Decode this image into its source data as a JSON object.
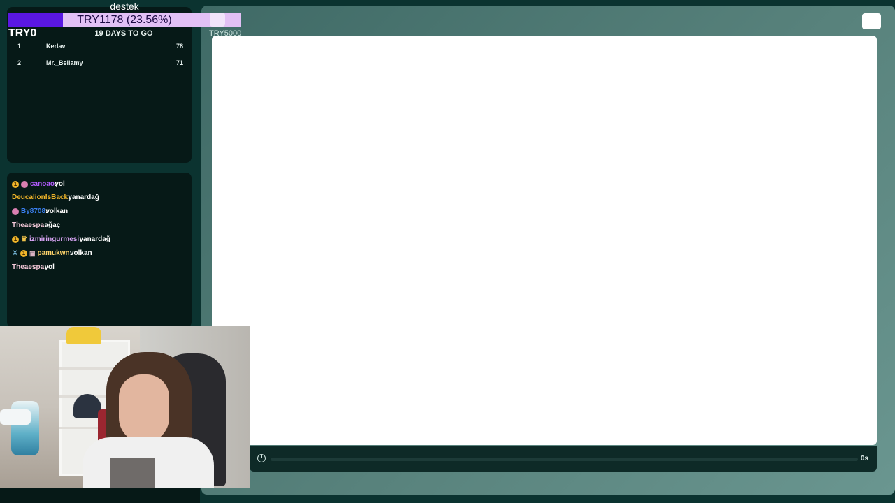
{
  "goal": {
    "title": "destek",
    "bar_label": "TRY1178 (23.56%)",
    "progress_percent": 23.56,
    "start_label": "TRY0",
    "end_label": "TRY5000",
    "days_left": "19 DAYS TO GO",
    "fill_color": "#5a17e3",
    "bar_color": "#e2c0f5"
  },
  "leaderboard": [
    {
      "rank": "1",
      "name": "Kerlav",
      "score": "78"
    },
    {
      "rank": "2",
      "name": "Mr._Bellamy",
      "score": "71"
    }
  ],
  "chat": [
    {
      "badges": [
        "badge-gold",
        "badge-pink"
      ],
      "user": "canoao",
      "user_color": "#b35cff",
      "message": "yol"
    },
    {
      "badges": [],
      "user": "DeucalionIsBack",
      "user_color": "#f0b429",
      "message": "yanardağ"
    },
    {
      "badges": [
        "badge-pink"
      ],
      "user": "By8708",
      "user_color": "#3a7ff0",
      "message": "volkan"
    },
    {
      "badges": [],
      "user": "Theaespa",
      "user_color": "#f2c8d8",
      "message": "ağaç"
    },
    {
      "badges": [
        "badge-gold",
        "badge-crown"
      ],
      "user": "izmiringurmesi",
      "user_color": "#d9a4f5",
      "message": "yanardağ"
    },
    {
      "badges": [
        "badge-sword",
        "badge-gold",
        "badge-bot"
      ],
      "user": "pamukwn",
      "user_color": "#ffd36b",
      "message": "volkan"
    },
    {
      "badges": [],
      "user": "Theaespa",
      "user_color": "#f2c8d8",
      "message": "yol"
    }
  ],
  "timer": {
    "value": "0s"
  },
  "icons": {
    "timer": "stopwatch-icon"
  }
}
